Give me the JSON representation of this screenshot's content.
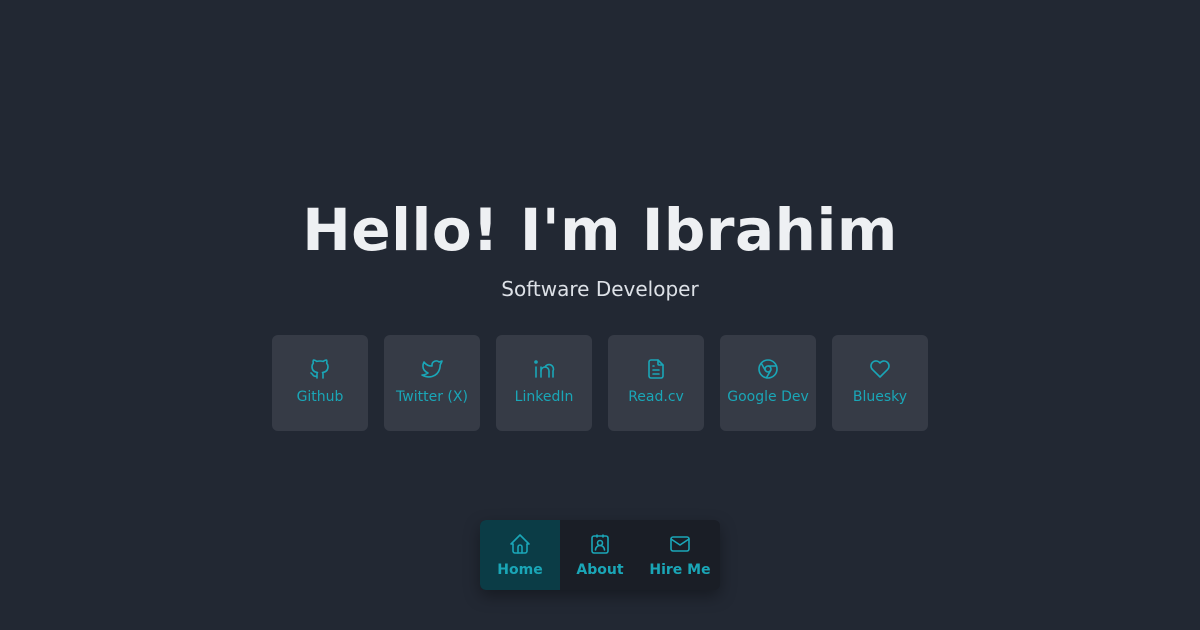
{
  "hero": {
    "title": "Hello! I'm Ibrahim",
    "subtitle": "Software Developer"
  },
  "links": [
    {
      "label": "Github",
      "icon": "github-icon"
    },
    {
      "label": "Twitter (X)",
      "icon": "twitter-icon"
    },
    {
      "label": "LinkedIn",
      "icon": "linkedin-icon"
    },
    {
      "label": "Read.cv",
      "icon": "document-icon"
    },
    {
      "label": "Google Dev",
      "icon": "chrome-icon"
    },
    {
      "label": "Bluesky",
      "icon": "heart-icon"
    }
  ],
  "dock": {
    "items": [
      {
        "label": "Home",
        "icon": "home-icon",
        "active": true
      },
      {
        "label": "About",
        "icon": "user-badge-icon",
        "active": false
      },
      {
        "label": "Hire Me",
        "icon": "mail-icon",
        "active": false
      }
    ]
  },
  "colors": {
    "background": "#222833",
    "card": "#363b46",
    "accent": "#1aa6b7",
    "dock": "#1a1e26",
    "dock_active": "#0b3c46",
    "title": "#eef0f3"
  }
}
